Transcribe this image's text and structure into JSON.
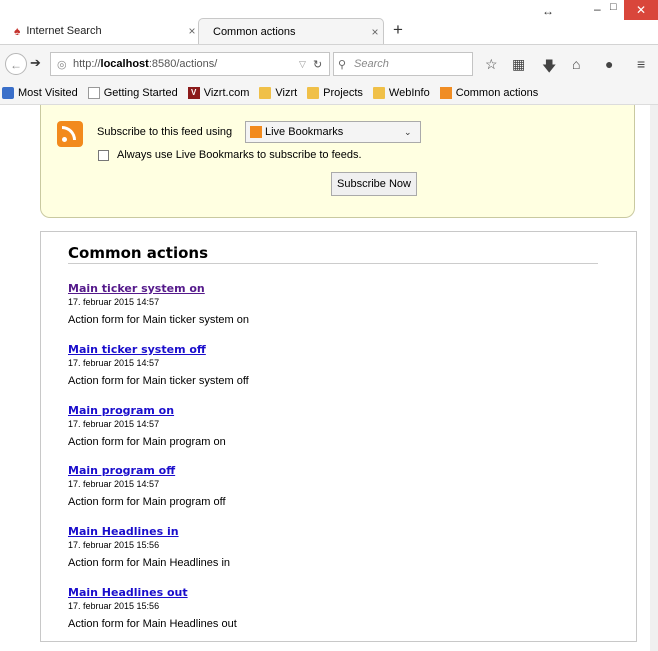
{
  "tabs": [
    {
      "label": "Internet Search",
      "active": false
    },
    {
      "label": "Common actions",
      "active": true
    }
  ],
  "toolbar": {
    "url_prefix": "http://",
    "url_host": "localhost",
    "url_rest": ":8580/actions/",
    "search_placeholder": "Search"
  },
  "bookmarks": [
    {
      "label": "Most Visited",
      "icon": "most-visited-icon"
    },
    {
      "label": "Getting Started",
      "icon": "page-icon"
    },
    {
      "label": "Vizrt.com",
      "icon": "vizrt-icon"
    },
    {
      "label": "Vizrt",
      "icon": "folder-icon"
    },
    {
      "label": "Projects",
      "icon": "folder-icon"
    },
    {
      "label": "WebInfo",
      "icon": "folder-icon"
    },
    {
      "label": "Common actions",
      "icon": "rss-icon"
    }
  ],
  "feed": {
    "subscribe_text": "Subscribe to this feed using",
    "reader": "Live Bookmarks",
    "always_label": "Always use Live Bookmarks to subscribe to feeds.",
    "button_label": "Subscribe Now"
  },
  "heading": "Common actions",
  "entries": [
    {
      "title": "Main ticker system on",
      "date": "17. februar 2015 14:57",
      "desc": "Action form for Main ticker system on",
      "visited": true
    },
    {
      "title": "Main ticker system off",
      "date": "17. februar 2015 14:57",
      "desc": "Action form for Main ticker system off",
      "visited": false
    },
    {
      "title": "Main program on",
      "date": "17. februar 2015 14:57",
      "desc": "Action form for Main program on",
      "visited": false
    },
    {
      "title": "Main program off",
      "date": "17. februar 2015 14:57",
      "desc": "Action form for Main program off",
      "visited": false
    },
    {
      "title": "Main Headlines in",
      "date": "17. februar 2015 15:56",
      "desc": "Action form for Main Headlines in",
      "visited": false
    },
    {
      "title": "Main Headlines out",
      "date": "17. februar 2015 15:56",
      "desc": "Action form for Main Headlines out",
      "visited": false
    }
  ]
}
